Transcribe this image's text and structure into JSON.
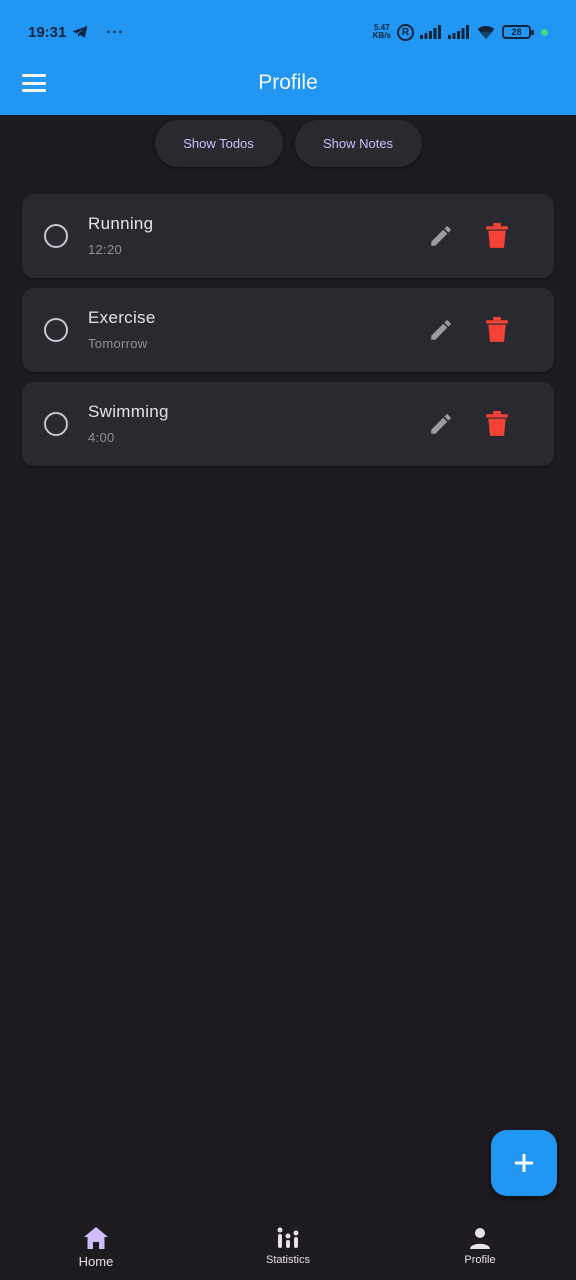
{
  "status_bar": {
    "time": "19:31",
    "more": "···",
    "net_speed_top": "5.47",
    "net_speed_bottom": "KB/s",
    "r_badge": "R",
    "battery": "28"
  },
  "app_bar": {
    "title": "Profile"
  },
  "filters": {
    "todos_label": "Show Todos",
    "notes_label": "Show Notes"
  },
  "todos": [
    {
      "title": "Running",
      "subtitle": "12:20"
    },
    {
      "title": "Exercise",
      "subtitle": "Tomorrow"
    },
    {
      "title": "Swimming",
      "subtitle": "4:00"
    }
  ],
  "bottom_nav": {
    "items": [
      {
        "label": "Home",
        "icon": "home-icon"
      },
      {
        "label": "Statistics",
        "icon": "statistics-icon"
      },
      {
        "label": "Profile",
        "icon": "person-icon"
      }
    ]
  },
  "colors": {
    "app_bar": "#2196f3",
    "background": "#1d1b20",
    "card": "#2b2930",
    "accent": "#d0bcff",
    "delete": "#f44336",
    "fab": "#2196f3"
  }
}
